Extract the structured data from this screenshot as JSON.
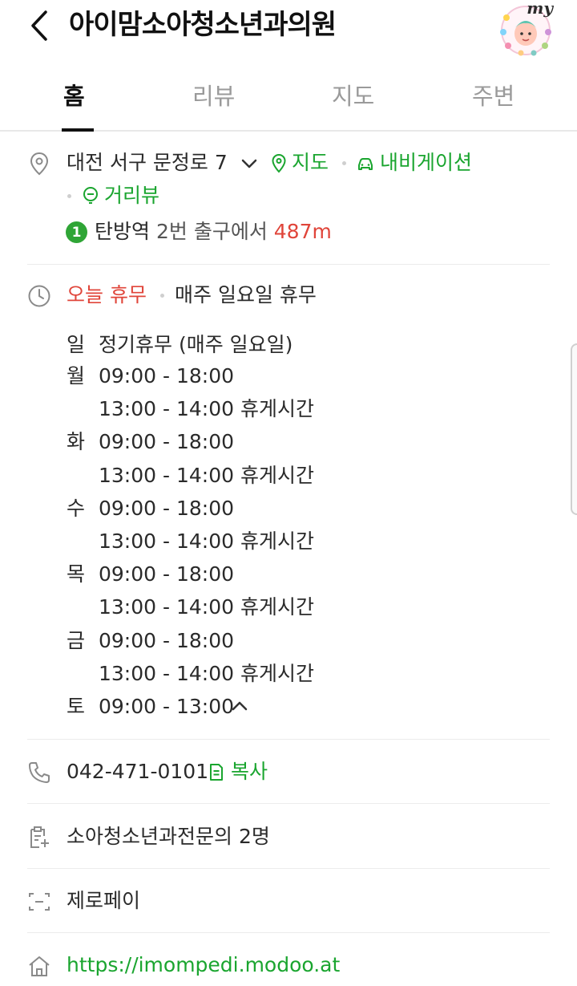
{
  "header": {
    "title": "아이맘소아청소년과의원",
    "avatar_badge": "my"
  },
  "tabs": [
    {
      "label": "홈",
      "active": true
    },
    {
      "label": "리뷰",
      "active": false
    },
    {
      "label": "지도",
      "active": false
    },
    {
      "label": "주변",
      "active": false
    }
  ],
  "address": {
    "text": "대전 서구 문정로 7",
    "map_link": "지도",
    "navigation_link": "내비게이션",
    "streetview_link": "거리뷰",
    "subway_line": "1",
    "station": "탄방역",
    "exit_text": "2번 출구에서",
    "distance": "487m"
  },
  "hours": {
    "status": "오늘 휴무",
    "summary": "매주 일요일 휴무",
    "schedule": [
      {
        "day": "일",
        "lines": [
          "정기휴무 (매주 일요일)"
        ]
      },
      {
        "day": "월",
        "lines": [
          "09:00 - 18:00",
          "13:00 - 14:00 휴게시간"
        ]
      },
      {
        "day": "화",
        "lines": [
          "09:00 - 18:00",
          "13:00 - 14:00 휴게시간"
        ]
      },
      {
        "day": "수",
        "lines": [
          "09:00 - 18:00",
          "13:00 - 14:00 휴게시간"
        ]
      },
      {
        "day": "목",
        "lines": [
          "09:00 - 18:00",
          "13:00 - 14:00 휴게시간"
        ]
      },
      {
        "day": "금",
        "lines": [
          "09:00 - 18:00",
          "13:00 - 14:00 휴게시간"
        ]
      },
      {
        "day": "토",
        "lines": [
          "09:00 - 13:00"
        ]
      }
    ]
  },
  "phone": {
    "number": "042-471-0101",
    "copy_label": "복사"
  },
  "doctors": {
    "text": "소아청소년과전문의 2명"
  },
  "payment": {
    "text": "제로페이"
  },
  "homepage": {
    "url": "https://imompedi.modoo.at"
  },
  "colors": {
    "accent_green": "#1aa52f",
    "alert_red": "#e0453a"
  }
}
